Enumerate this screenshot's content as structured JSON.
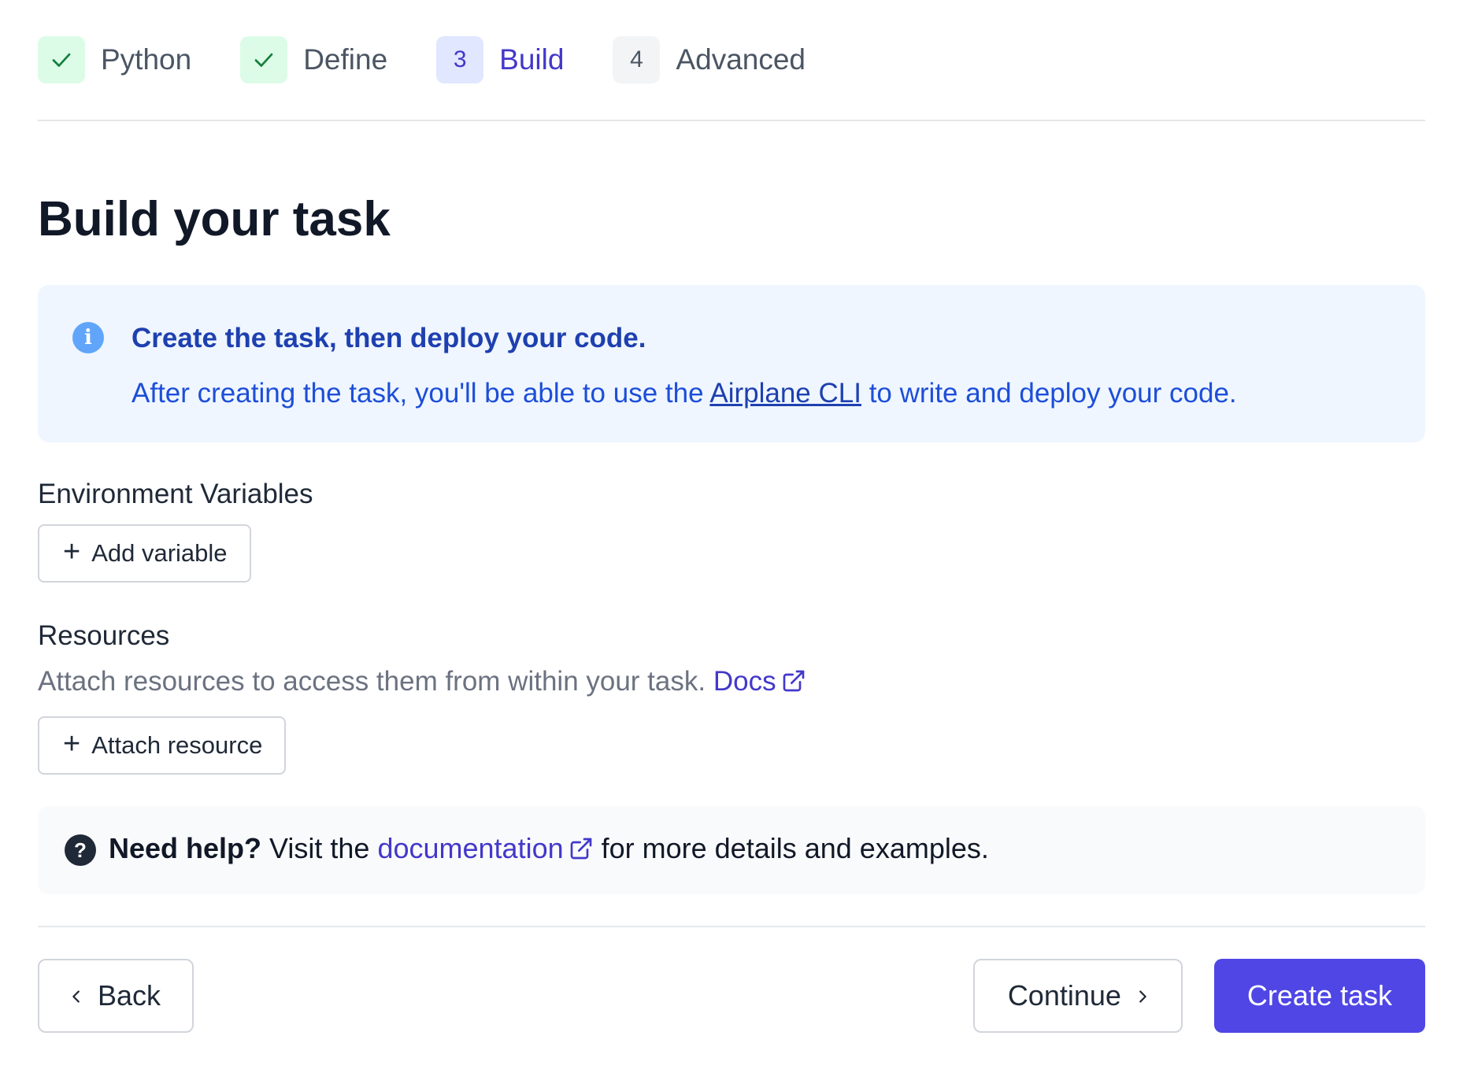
{
  "stepper": {
    "steps": [
      {
        "badge": "✓",
        "label": "Python",
        "state": "done"
      },
      {
        "badge": "✓",
        "label": "Define",
        "state": "done"
      },
      {
        "badge": "3",
        "label": "Build",
        "state": "active"
      },
      {
        "badge": "4",
        "label": "Advanced",
        "state": "todo"
      }
    ]
  },
  "page": {
    "title": "Build your task"
  },
  "callout": {
    "icon": "info-icon",
    "title": "Create the task, then deploy your code.",
    "text_before": "After creating the task, you'll be able to use the ",
    "link": "Airplane CLI",
    "text_after": " to write and deploy your code."
  },
  "env": {
    "heading": "Environment Variables",
    "add_label": "Add variable"
  },
  "resources": {
    "heading": "Resources",
    "desc": "Attach resources to access them from within your task. ",
    "docs_link": "Docs",
    "attach_label": "Attach resource"
  },
  "help": {
    "strong": "Need help?",
    "text_before": " Visit the ",
    "link": "documentation",
    "text_after": " for more details and examples."
  },
  "footer": {
    "back_label": "Back",
    "continue_label": "Continue",
    "create_label": "Create task"
  },
  "colors": {
    "accent": "#4f46e5",
    "done_bg": "#dcfce7",
    "info_bg": "#eff6ff"
  }
}
